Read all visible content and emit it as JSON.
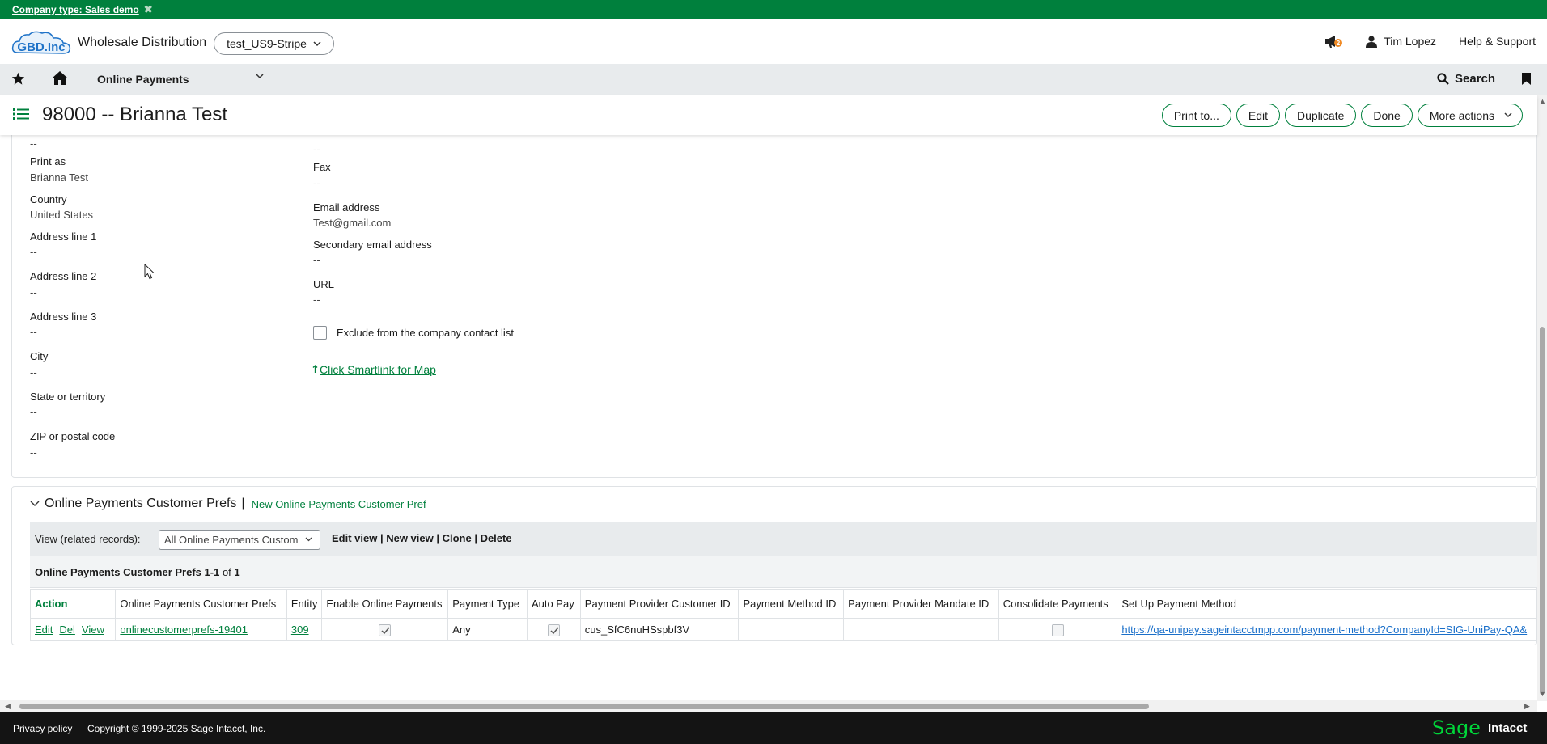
{
  "banner": {
    "text": "Company type: Sales demo",
    "close": "✖"
  },
  "header": {
    "logo_text": "GBD.Inc",
    "app_name": "Wholesale Distribution",
    "entity": "test_US9-Stripe",
    "user": "Tim Lopez",
    "help": "Help & Support",
    "notif_count": "2"
  },
  "nav": {
    "menu_title": "Online Payments",
    "search": "Search"
  },
  "titlebar": {
    "title": "98000 -- Brianna Test",
    "buttons": {
      "print": "Print to...",
      "edit": "Edit",
      "duplicate": "Duplicate",
      "done": "Done",
      "more": "More actions"
    }
  },
  "left_fields": {
    "top_value": "--",
    "print_as_label": "Print as",
    "print_as": "Brianna Test",
    "country_label": "Country",
    "country": "United States",
    "addr1_label": "Address line 1",
    "addr1": "--",
    "addr2_label": "Address line 2",
    "addr2": "--",
    "addr3_label": "Address line 3",
    "addr3": "--",
    "city_label": "City",
    "city": "--",
    "state_label": "State or territory",
    "state": "--",
    "zip_label": "ZIP or postal code",
    "zip": "--"
  },
  "right_fields": {
    "top_value": "--",
    "fax_label": "Fax",
    "fax": "--",
    "email_label": "Email address",
    "email": "Test@gmail.com",
    "email2_label": "Secondary email address",
    "email2": "--",
    "url_label": "URL",
    "url": "--",
    "exclude_label": "Exclude from the company contact list",
    "smartlink": "Click Smartlink for Map"
  },
  "prefs": {
    "section_title": "Online Payments Customer Prefs",
    "separator": "|",
    "new_link": "New Online Payments Customer Pref",
    "view_label": "View (related records):",
    "view_selected": "All Online Payments Custom",
    "view_ops": "Edit view | New view | Clone | Delete",
    "count_label": "Online Payments Customer Prefs",
    "count_range": "1-1",
    "count_of": "of",
    "count_total": "1",
    "columns": [
      "Action",
      "Online Payments Customer Prefs",
      "Entity",
      "Enable Online Payments",
      "Payment Type",
      "Auto Pay",
      "Payment Provider Customer ID",
      "Payment Method ID",
      "Payment Provider Mandate ID",
      "Consolidate Payments",
      "Set Up Payment Method"
    ],
    "row": {
      "edit": "Edit",
      "del": "Del",
      "view": "View",
      "pref_id": "onlinecustomerprefs-19401",
      "entity": "309",
      "payment_type": "Any",
      "provider_customer_id": "cus_SfC6nuHSspbf3V",
      "method_id": "",
      "mandate_id": "",
      "setup_url": "https://qa-unipay.sageintacctmpp.com/payment-method?CompanyId=SIG-UniPay-QA&"
    }
  },
  "footer": {
    "privacy": "Privacy policy",
    "copyright": "Copyright © 1999-2025 Sage Intacct, Inc.",
    "sage": "Sage",
    "intacct": "Intacct"
  },
  "colors": {
    "brand_green": "#00803d",
    "footer_bg": "#141414",
    "nav_bg": "#e8ebed"
  }
}
